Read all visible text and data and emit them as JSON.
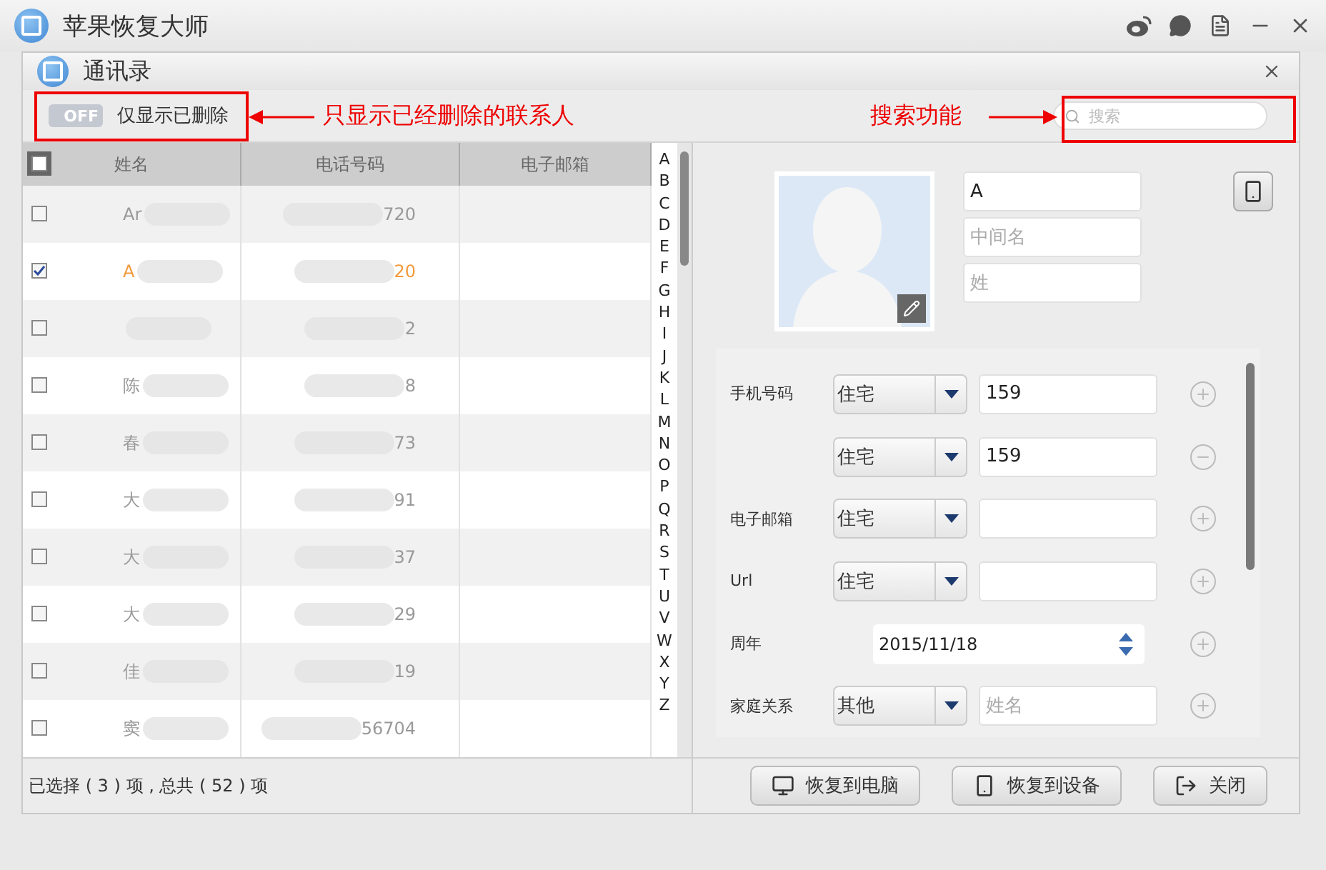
{
  "app": {
    "title": "苹果恢复大师"
  },
  "dialog": {
    "title": "通讯录"
  },
  "toolbar": {
    "toggle": {
      "label": "OFF",
      "on": false
    },
    "filter_label": "仅显示已删除",
    "search": {
      "placeholder": "搜索"
    }
  },
  "annotations": [
    {
      "text": "只显示已经删除的联系人"
    },
    {
      "text": "搜索功能"
    }
  ],
  "table": {
    "select_all_checked": false,
    "columns": [
      "姓名",
      "电话号码",
      "电子邮箱"
    ],
    "rows": [
      {
        "name": "Ar",
        "phone": "720",
        "checked": false
      },
      {
        "name": "A",
        "phone": "20",
        "checked": true
      },
      {
        "phone": "2",
        "checked": false
      },
      {
        "name": "陈",
        "phone": "8",
        "checked": false
      },
      {
        "name": "春",
        "phone": "73",
        "checked": false
      },
      {
        "name": "大",
        "phone": "91",
        "checked": false
      },
      {
        "name": "大",
        "phone": "37",
        "checked": false
      },
      {
        "name": "大",
        "phone": "29",
        "checked": false
      },
      {
        "name": "佳",
        "phone": "19",
        "checked": false
      },
      {
        "name": "窦",
        "phone": "56704",
        "checked": false
      }
    ]
  },
  "index_letters": [
    "A",
    "B",
    "C",
    "D",
    "E",
    "F",
    "G",
    "H",
    "I",
    "J",
    "K",
    "L",
    "M",
    "N",
    "O",
    "P",
    "Q",
    "R",
    "S",
    "T",
    "U",
    "V",
    "W",
    "X",
    "Y",
    "Z"
  ],
  "status": "已选择 ( 3 ) 项 , 总共 ( 52 ) 项",
  "contact": {
    "first_name": "A",
    "middle_placeholder": "中间名",
    "last_placeholder": "姓",
    "fields": [
      {
        "kind": "select",
        "label": "手机号码",
        "type": "住宅",
        "value": "159",
        "removable": false
      },
      {
        "kind": "select",
        "type": "住宅",
        "value": "159",
        "removable": true
      },
      {
        "kind": "select",
        "label": "电子邮箱",
        "type": "住宅",
        "removable": false
      },
      {
        "kind": "select",
        "label": "Url",
        "type": "住宅",
        "removable": false
      },
      {
        "kind": "date",
        "label": "周年",
        "value": "2015/11/18",
        "removable": false
      },
      {
        "kind": "select",
        "label": "家庭关系",
        "type": "其他",
        "placeholder": "姓名",
        "removable": false
      }
    ]
  },
  "buttons": [
    {
      "label": "恢复到电脑",
      "kind": "computer"
    },
    {
      "label": "恢复到设备",
      "kind": "device"
    },
    {
      "label": "关闭",
      "kind": "close"
    }
  ]
}
